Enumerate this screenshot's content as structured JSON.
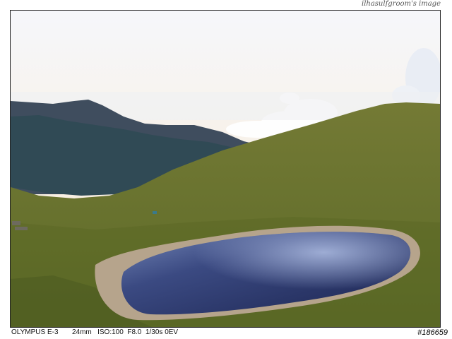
{
  "watermark": "ilhasulfgroom's image",
  "exif": {
    "camera": "OLYMPUS E-3",
    "focal_length": "24mm",
    "iso": "ISO:100",
    "aperture": "F8.0",
    "shutter": "1/30s",
    "ev": "0EV"
  },
  "photo_id": "#186659",
  "colors": {
    "sky_top": "#f4f4f8",
    "sky_horizon": "#f6ead8",
    "clouds": "#ffffff",
    "far_mountain": "#3c4b5c",
    "near_mountain": "#2f4a52",
    "grass": "#6b7530",
    "grass_dark": "#4d5a24",
    "shore": "#b8a48c",
    "lake_deep": "#1f2a55",
    "lake_reflection": "#7f93c4"
  }
}
